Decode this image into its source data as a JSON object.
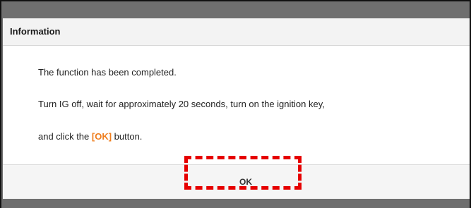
{
  "dialog": {
    "title": "Information",
    "message_line1": "The function has been completed.",
    "message_line2": "Turn IG off, wait for approximately 20 seconds, turn on the ignition key,",
    "message_line3_prefix": "and click the ",
    "message_line3_highlight": "[OK]",
    "message_line3_suffix": " button.",
    "ok_label": "OK"
  },
  "colors": {
    "highlight_text": "#ef7d1d",
    "annotation_box": "#e60000",
    "overlay": "#6e6e6e"
  }
}
